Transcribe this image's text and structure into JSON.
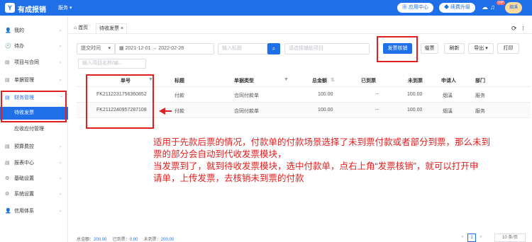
{
  "topbar": {
    "app_name": "有成报销",
    "service": "服务",
    "service_caret": "▾",
    "app_center": "应用中心",
    "renew": "续费升级",
    "vip": "VIP",
    "user": "烟溪"
  },
  "sidebar": {
    "items": [
      {
        "icon": "👤",
        "label": "我的",
        "arrow": "›"
      },
      {
        "icon": "🕘",
        "label": "待办",
        "arrow": "›"
      },
      {
        "icon": "▤",
        "label": "项目与合同",
        "arrow": "›"
      },
      {
        "icon": "▤",
        "label": "单据管理",
        "arrow": "›"
      },
      {
        "icon": "▤",
        "label": "财务管理",
        "arrow": "⌃"
      },
      {
        "label": "待收发票"
      },
      {
        "label": "应收应付管理"
      },
      {
        "icon": "▤",
        "label": "预算费控",
        "arrow": "›"
      },
      {
        "icon": "▤",
        "label": "报表中心",
        "arrow": "›"
      },
      {
        "icon": "⚙",
        "label": "基础设置",
        "arrow": "›"
      },
      {
        "icon": "⚙",
        "label": "系统设置",
        "arrow": "›"
      },
      {
        "icon": "👤",
        "label": "信用体系",
        "arrow": "›"
      }
    ]
  },
  "tabs": {
    "home": "首页",
    "current": "待收发票",
    "close": "×",
    "refresh_icon": "⟳",
    "more_icon": "⁝"
  },
  "filters": {
    "time_type": "提交时间",
    "time_caret": "▾",
    "date_from": "2021-12-01",
    "date_sep": "→",
    "date_to": "2022-02-28",
    "keyword_placeholder": "输入标题",
    "project_placeholder": "请选择辅助项目",
    "name_placeholder": "输入项目名称/编..."
  },
  "actions": {
    "verify": "发票核销",
    "remind": "催票",
    "refresh": "刷新",
    "export": "导出",
    "print": "打印"
  },
  "table": {
    "columns": [
      "单号",
      "标题",
      "单据类型",
      "总金额",
      "已到票",
      "未到票",
      "申请人",
      "部门"
    ],
    "rows": [
      [
        "FK2112231756360852",
        "付款",
        "合同付款单",
        "100.00",
        "--",
        "100.00",
        "烟溪",
        "服务"
      ],
      [
        "FK2112240957287108",
        "付款",
        "合同付款单",
        "100.00",
        "--",
        "100.00",
        "烟溪",
        "服务"
      ]
    ]
  },
  "annotation": {
    "line1": "适用于先款后票的情况，付款单的付款场景选择了未到票付款或者部分到票，那么未到",
    "line2": "票的部分会自动到代收发票模块，",
    "line3": "当发票到了，就到待收发票模块，选中付款单，点右上角“发票核销”，就可以打开申",
    "line4": "请单，上传发票，去核销未到票的付款"
  },
  "footer": {
    "total_label": "总金额：",
    "total_value": "200.00",
    "received_label": "已到票：",
    "received_value": "0.00",
    "pending_label": "未到票：",
    "pending_value": "200.00",
    "page_prev": "‹",
    "page_num": "1",
    "page_next": "›",
    "page_size": "10 条/页"
  },
  "colors": {
    "brand": "#1e6fe8",
    "highlight": "#e02020"
  }
}
